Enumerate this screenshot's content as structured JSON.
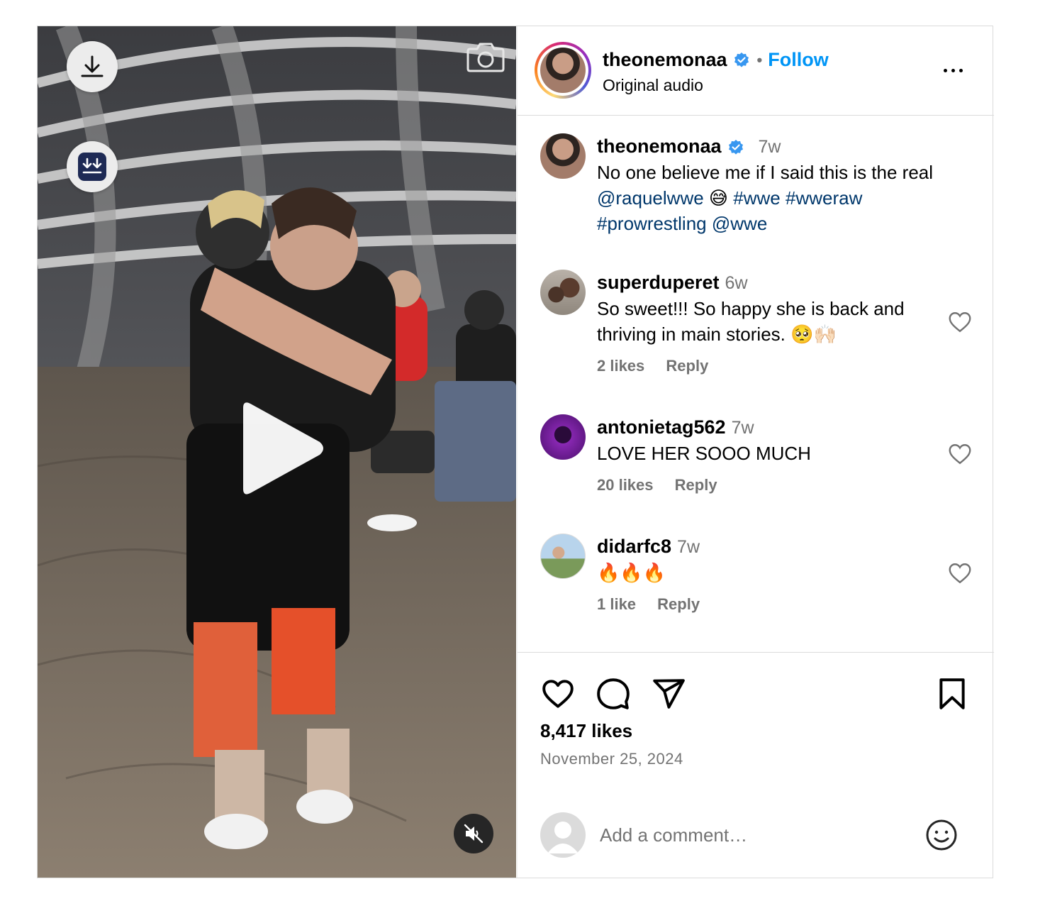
{
  "header": {
    "username": "theonemonaa",
    "separator": "•",
    "follow_label": "Follow",
    "audio": "Original audio"
  },
  "caption": {
    "username": "theonemonaa",
    "time": "7w",
    "text_plain": "No one believe me if I said this is the real",
    "tokens": [
      "@raquelwwe",
      "😅",
      "#wwe",
      "#wweraw",
      "#prowrestling",
      "@wwe"
    ]
  },
  "comments": [
    {
      "username": "superduperet",
      "time": "6w",
      "text": "So sweet!!! So happy she is back and thriving in main stories. 🥺🙌🏻",
      "likes": "2 likes",
      "reply": "Reply"
    },
    {
      "username": "antonietag562",
      "time": "7w",
      "text": "LOVE HER SOOO MUCH",
      "likes": "20 likes",
      "reply": "Reply"
    },
    {
      "username": "didarfc8",
      "time": "7w",
      "text": "🔥🔥🔥",
      "likes": "1 like",
      "reply": "Reply"
    }
  ],
  "post": {
    "likes": "8,417 likes",
    "date": "November 25, 2024"
  },
  "add_comment": {
    "placeholder": "Add a comment…"
  },
  "icons": {
    "download": "download-icon",
    "saver": "double-download-icon",
    "camera": "camera-icon",
    "play": "play-icon",
    "mute": "speaker-muted-icon",
    "verified": "verified-badge-icon",
    "more": "more-options-icon",
    "like": "heart-icon",
    "comment": "comment-bubble-icon",
    "share": "paper-plane-icon",
    "save": "bookmark-icon",
    "emoji": "smiley-icon"
  },
  "colors": {
    "follow_blue": "#0095f6",
    "link_blue": "#00376b",
    "muted_gray": "#737373",
    "verified_blue": "#3897f0"
  }
}
